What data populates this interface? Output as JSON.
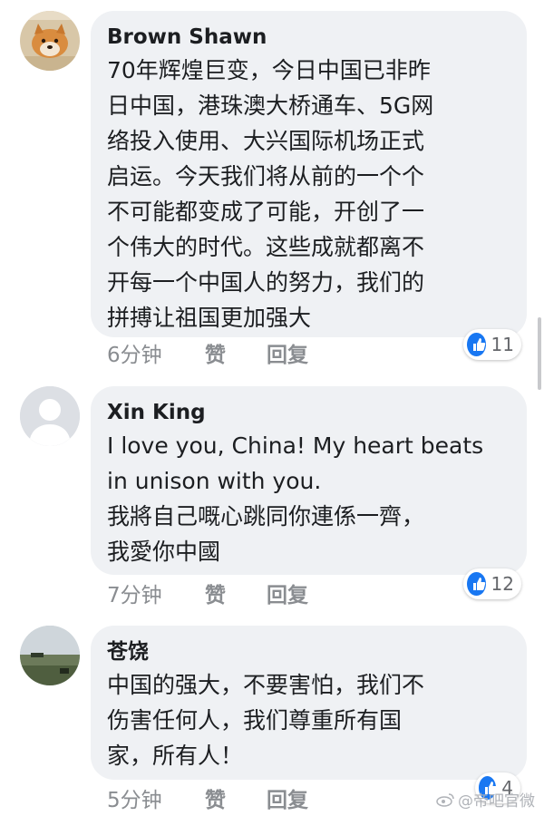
{
  "comments": [
    {
      "author": "Brown Shawn",
      "avatar": "shiba-dog-avatar",
      "lines": [
        "70年辉煌巨变，今日中国已非昨",
        "日中国，港珠澳大桥通车、5G网",
        "络投入使用、大兴国际机场正式",
        "启运。今天我们将从前的一个个",
        "不可能都变成了可能，开创了一",
        "个伟大的时代。这些成就都离不",
        "开每一个中国人的努力，我们的",
        "拼搏让祖国更加强大"
      ],
      "time": "6分钟",
      "like_label": "赞",
      "reply_label": "回复",
      "reaction_count": "11"
    },
    {
      "author": "Xin King",
      "avatar": "default-user-avatar",
      "lines": [
        "I love you, China! My heart beats",
        "in unison with you.",
        "我將自己嘅心跳同你連係一齊，",
        "我愛你中國"
      ],
      "time": "7分钟",
      "like_label": "赞",
      "reply_label": "回复",
      "reaction_count": "12"
    },
    {
      "author": "苍饶",
      "avatar": "landscape-avatar",
      "lines": [
        "中国的强大，不要害怕，我们不",
        "伤害任何人，我们尊重所有国",
        "家，所有人！"
      ],
      "time": "5分钟",
      "like_label": "赞",
      "reply_label": "回复",
      "reaction_count": "4"
    }
  ],
  "watermark": "@帝吧官微",
  "colors": {
    "bubble": "#eff1f4",
    "like_blue": "#1877f2",
    "meta_gray": "#8a8d91"
  }
}
